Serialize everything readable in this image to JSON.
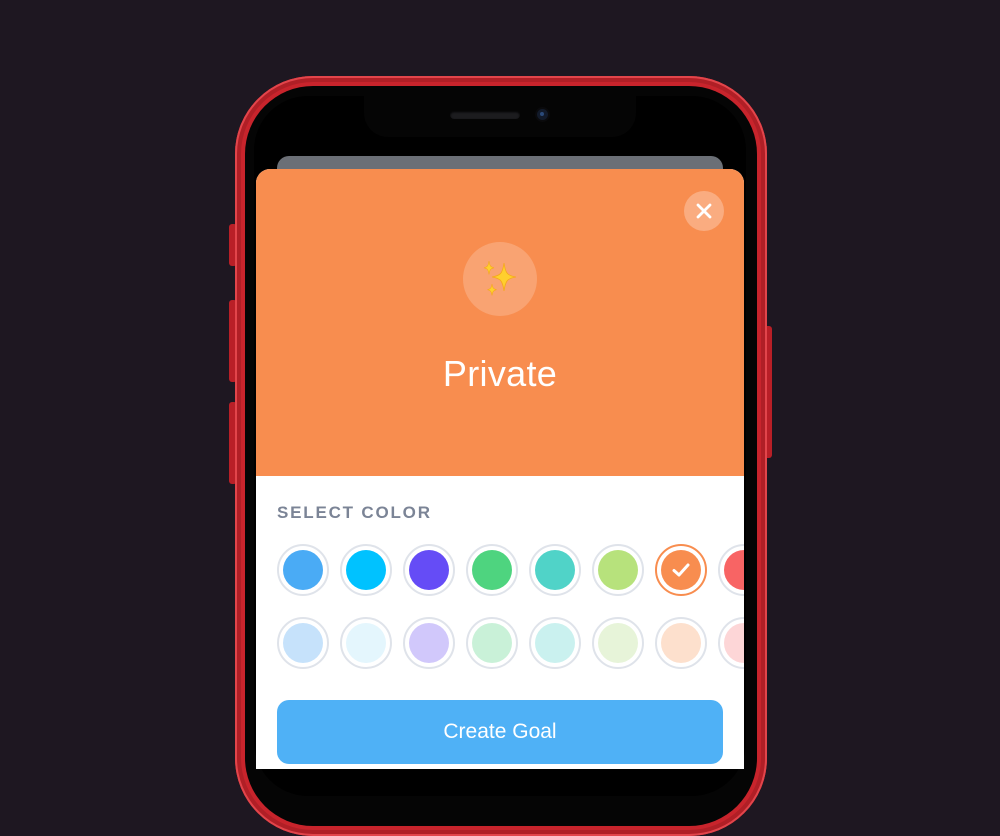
{
  "goal": {
    "title": "Private",
    "emoji": "✨",
    "header_color": "#f88d4f"
  },
  "color_picker": {
    "label": "SELECT COLOR",
    "selected_index": 6,
    "row1": [
      "#4aabf5",
      "#00c2ff",
      "#654cf6",
      "#4ed47f",
      "#50d3c8",
      "#b7e27c",
      "#f88d4f",
      "#f86464"
    ],
    "row2": [
      "#c6e2fb",
      "#e4f6fd",
      "#d1c8fb",
      "#c9f1d8",
      "#caf1ef",
      "#e7f4d9",
      "#fde0cd",
      "#fdd6d7"
    ]
  },
  "actions": {
    "close_icon": "close-icon",
    "create_label": "Create Goal",
    "create_color": "#4fb1f6"
  }
}
